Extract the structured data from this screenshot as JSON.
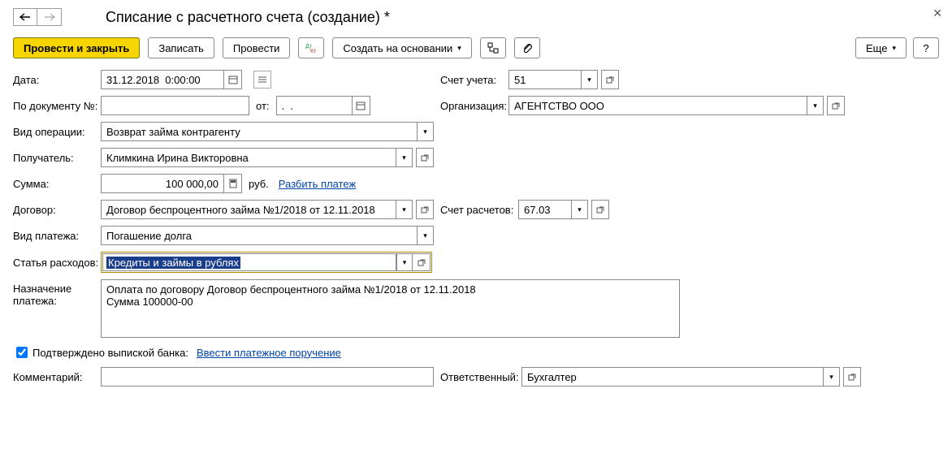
{
  "header": {
    "title": "Списание с расчетного счета (создание) *"
  },
  "toolbar": {
    "post_close": "Провести и закрыть",
    "save": "Записать",
    "post": "Провести",
    "create_based": "Создать на основании",
    "more": "Еще"
  },
  "labels": {
    "date": "Дата:",
    "account": "Счет учета:",
    "docnum": "По документу №:",
    "from": "от:",
    "org": "Организация:",
    "optype": "Вид операции:",
    "recipient": "Получатель:",
    "sum": "Сумма:",
    "rub": "руб.",
    "split": "Разбить платеж",
    "contract": "Договор:",
    "settle_acc": "Счет расчетов:",
    "paytype": "Вид платежа:",
    "expense": "Статья расходов:",
    "purpose": "Назначение платежа:",
    "confirmed": "Подтверждено выпиской банка:",
    "enter_order": "Ввести платежное поручение",
    "comment": "Комментарий:",
    "responsible": "Ответственный:"
  },
  "values": {
    "date": "31.12.2018  0:00:00",
    "account": "51",
    "docnum": "",
    "docdate": ".  .",
    "org": "АГЕНТСТВО ООО",
    "optype": "Возврат займа контрагенту",
    "recipient": "Климкина Ирина Викторовна",
    "sum": "100 000,00",
    "contract": "Договор беспроцентного займа №1/2018 от 12.11.2018",
    "settle_acc": "67.03",
    "paytype": "Погашение долга",
    "expense": "Кредиты и займы в рублях",
    "purpose": "Оплата по договору Договор беспроцентного займа №1/2018 от 12.11.2018\nСумма 100000-00",
    "comment": "",
    "responsible": "Бухгалтер"
  }
}
